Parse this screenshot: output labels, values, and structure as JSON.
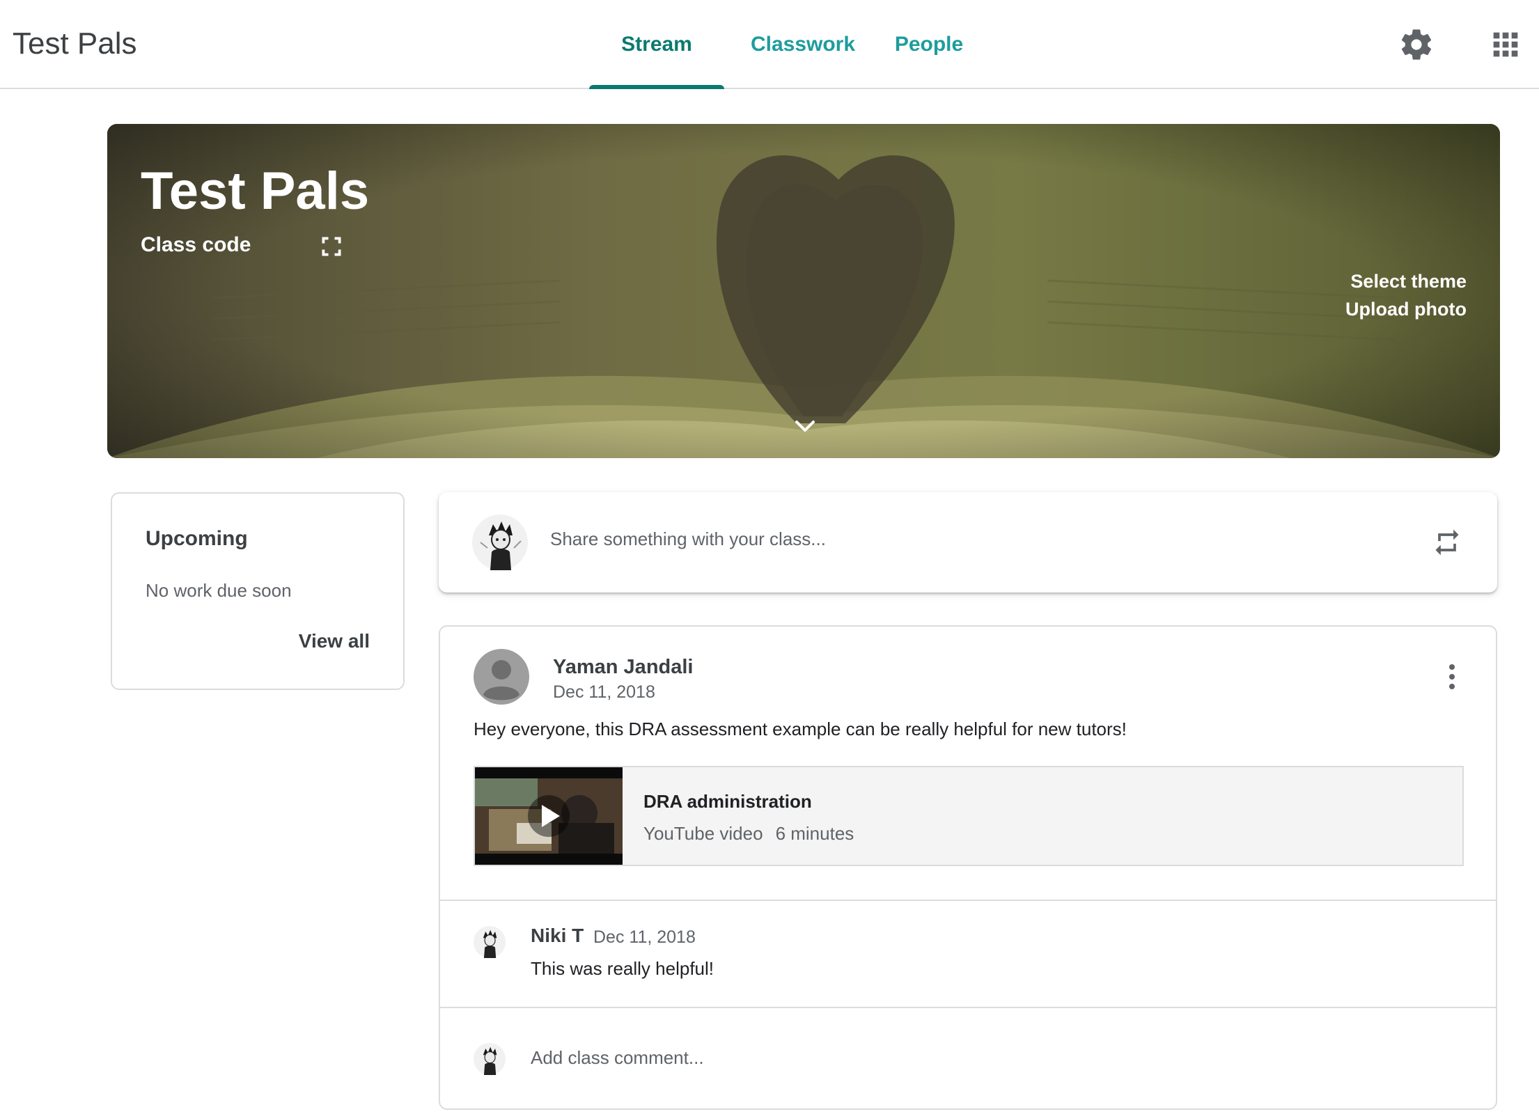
{
  "header": {
    "app_title": "Test Pals",
    "tabs": [
      {
        "label": "Stream",
        "active": true
      },
      {
        "label": "Classwork",
        "active": false
      },
      {
        "label": "People",
        "active": false
      }
    ],
    "icons": [
      "gear-icon",
      "apps-grid-icon"
    ],
    "accent_color": "#0b7a6e"
  },
  "banner": {
    "title": "Test Pals",
    "class_code_label": "Class code",
    "select_theme": "Select theme",
    "upload_photo": "Upload photo"
  },
  "upcoming": {
    "title": "Upcoming",
    "empty_text": "No work due soon",
    "view_all": "View all"
  },
  "share": {
    "placeholder": "Share something with your class..."
  },
  "post": {
    "author": "Yaman Jandali",
    "date": "Dec 11, 2018",
    "text": "Hey everyone, this DRA assessment example can be really helpful for new tutors!",
    "attachment": {
      "title": "DRA administration",
      "source": "YouTube video",
      "duration": "6 minutes"
    },
    "comments": [
      {
        "author": "Niki T",
        "date": "Dec 11, 2018",
        "text": "This was really helpful!"
      }
    ],
    "add_comment_placeholder": "Add class comment..."
  }
}
